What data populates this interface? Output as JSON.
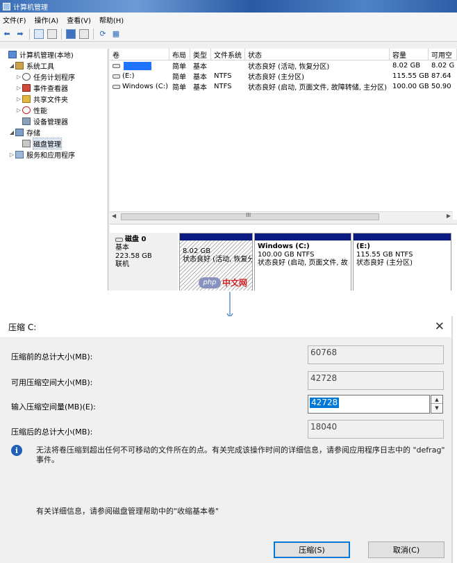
{
  "cm_window": {
    "title": "计算机管理",
    "menu": [
      "文件(F)",
      "操作(A)",
      "查看(V)",
      "帮助(H)"
    ],
    "tree": [
      {
        "label": "计算机管理(本地)",
        "icon": "computer-icon",
        "level": 0,
        "arrow": ""
      },
      {
        "label": "系统工具",
        "icon": "tools-icon",
        "level": 1,
        "arrow": "◢"
      },
      {
        "label": "任务计划程序",
        "icon": "clock-icon",
        "level": 2,
        "arrow": "▷"
      },
      {
        "label": "事件查看器",
        "icon": "event-viewer-icon",
        "level": 2,
        "arrow": "▷"
      },
      {
        "label": "共享文件夹",
        "icon": "shared-folder-icon",
        "level": 2,
        "arrow": "▷"
      },
      {
        "label": "性能",
        "icon": "performance-icon",
        "level": 2,
        "arrow": "▷"
      },
      {
        "label": "设备管理器",
        "icon": "device-manager-icon",
        "level": 2,
        "arrow": ""
      },
      {
        "label": "存储",
        "icon": "storage-icon",
        "level": 1,
        "arrow": "◢"
      },
      {
        "label": "磁盘管理",
        "icon": "disk-management-icon",
        "level": 2,
        "arrow": "",
        "selected": true
      },
      {
        "label": "服务和应用程序",
        "icon": "services-icon",
        "level": 1,
        "arrow": "▷"
      }
    ],
    "volume_headers": [
      "卷",
      "布局",
      "类型",
      "文件系统",
      "状态",
      "容量",
      "可用空"
    ],
    "volumes": [
      {
        "name": "",
        "redacted": true,
        "layout": "简单",
        "type": "基本",
        "fs": "",
        "status": "状态良好 (活动, 恢复分区)",
        "capacity": "8.02 GB",
        "free": "8.02 G"
      },
      {
        "name": "(E:)",
        "redacted": false,
        "layout": "简单",
        "type": "基本",
        "fs": "NTFS",
        "status": "状态良好 (主分区)",
        "capacity": "115.55 GB",
        "free": "87.64"
      },
      {
        "name": "Windows (C:)",
        "redacted": false,
        "layout": "简单",
        "type": "基本",
        "fs": "NTFS",
        "status": "状态良好 (启动, 页面文件, 故障转储, 主分区)",
        "capacity": "100.00 GB",
        "free": "50.90"
      }
    ],
    "scroll_grip": "III",
    "disk": {
      "name": "磁盘 0",
      "type": "基本",
      "size": "223.58 GB",
      "status": "联机",
      "partitions": [
        {
          "name": "",
          "size": "8.02 GB",
          "status": "状态良好 (活动, 恢复分"
        },
        {
          "name": "Windows  (C:)",
          "size": "100.00 GB NTFS",
          "status": "状态良好 (启动, 页面文件, 故"
        },
        {
          "name": "(E:)",
          "size": "115.55 GB NTFS",
          "status": "状态良好 (主分区)"
        }
      ]
    }
  },
  "watermark": {
    "logo": "php",
    "text": "中文网"
  },
  "dialog": {
    "title": "压缩 C:",
    "rows": [
      {
        "label": "压缩前的总计大小(MB):",
        "value": "60768"
      },
      {
        "label": "可用压缩空间大小(MB):",
        "value": "42728"
      },
      {
        "label": "输入压缩空间量(MB)(E):",
        "value": "42728"
      },
      {
        "label": "压缩后的总计大小(MB):",
        "value": "18040"
      }
    ],
    "info_icon_glyph": "i",
    "info_text": "无法将卷压缩到超出任何不可移动的文件所在的点。有关完成该操作时间的详细信息，请参阅应用程序日志中的 \"defrag\" 事件。",
    "help_text": "有关详细信息，请参阅磁盘管理帮助中的\"收缩基本卷\"",
    "shrink_button": "压缩(S)",
    "cancel_button": "取消(C)"
  }
}
